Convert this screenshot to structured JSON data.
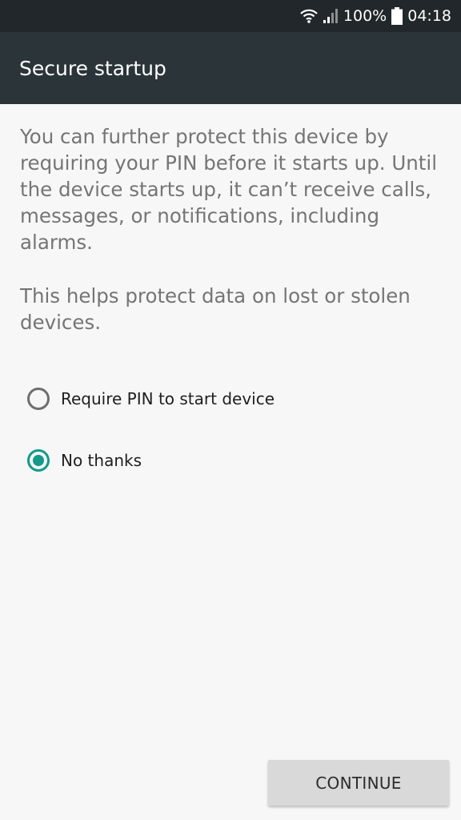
{
  "status_bar": {
    "icons": [
      "wifi-icon",
      "signal-icon",
      "battery-icon"
    ],
    "battery": "100%",
    "time": "04:18"
  },
  "app_bar": {
    "title": "Secure startup"
  },
  "description": {
    "paragraph1": "You can further protect this device by requiring your PIN before it starts up. Until the device starts up, it can’t receive calls, messages, or notifications, including alarms.",
    "paragraph2": "This helps protect data on lost or stolen devices."
  },
  "options": [
    {
      "label": "Require PIN to start device",
      "selected": false
    },
    {
      "label": "No thanks",
      "selected": true
    }
  ],
  "actions": {
    "continue_label": "CONTINUE"
  },
  "colors": {
    "status_bar": "#21272b",
    "app_bar": "#2a3439",
    "background": "#f7f7f7",
    "accent": "#139a8a",
    "button": "#d9d9d9"
  }
}
